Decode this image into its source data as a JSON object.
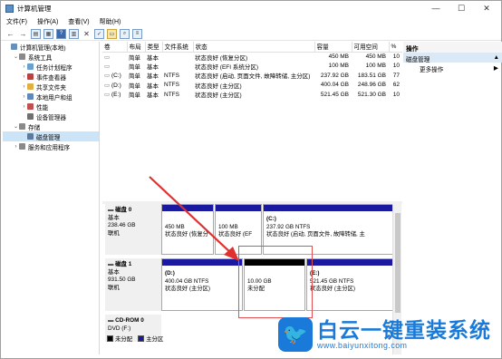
{
  "window": {
    "title": "计算机管理",
    "controls": [
      "—",
      "☐",
      "✕"
    ]
  },
  "menu": [
    "文件(F)",
    "操作(A)",
    "查看(V)",
    "帮助(H)"
  ],
  "tree": [
    {
      "label": "计算机管理(本地)",
      "level": 0,
      "expander": "",
      "color": "#6a8fb8"
    },
    {
      "label": "系统工具",
      "level": 1,
      "expander": "⌄",
      "color": "#8a8a8a"
    },
    {
      "label": "任务计划程序",
      "level": 2,
      "expander": "›",
      "color": "#6aa0d0"
    },
    {
      "label": "事件查看器",
      "level": 2,
      "expander": "›",
      "color": "#c04040"
    },
    {
      "label": "共享文件夹",
      "level": 2,
      "expander": "›",
      "color": "#e0b040"
    },
    {
      "label": "本地用户和组",
      "level": 2,
      "expander": "›",
      "color": "#5a8ac0"
    },
    {
      "label": "性能",
      "level": 2,
      "expander": "›",
      "color": "#c05050"
    },
    {
      "label": "设备管理器",
      "level": 2,
      "expander": "",
      "color": "#707070"
    },
    {
      "label": "存储",
      "level": 1,
      "expander": "⌄",
      "color": "#8a8a8a"
    },
    {
      "label": "磁盘管理",
      "level": 2,
      "expander": "",
      "color": "#5a7aa0",
      "selected": true
    },
    {
      "label": "服务和应用程序",
      "level": 1,
      "expander": "›",
      "color": "#8a8a8a"
    }
  ],
  "volume_table": {
    "headers": [
      "卷",
      "布局",
      "类型",
      "文件系统",
      "状态",
      "容量",
      "可用空间",
      "%"
    ],
    "rows": [
      [
        "",
        "简单",
        "基本",
        "",
        "状态良好 (恢复分区)",
        "450 MB",
        "450 MB",
        "10"
      ],
      [
        "",
        "简单",
        "基本",
        "",
        "状态良好 (EFI 系统分区)",
        "100 MB",
        "100 MB",
        "10"
      ],
      [
        "(C:)",
        "简单",
        "基本",
        "NTFS",
        "状态良好 (启动, 页面文件, 故障转储, 主分区)",
        "237.92 GB",
        "183.51 GB",
        "77"
      ],
      [
        "(D:)",
        "简单",
        "基本",
        "NTFS",
        "状态良好 (主分区)",
        "400.04 GB",
        "248.96 GB",
        "62"
      ],
      [
        "(E:)",
        "简单",
        "基本",
        "NTFS",
        "状态良好 (主分区)",
        "521.45 GB",
        "521.30 GB",
        "10"
      ]
    ]
  },
  "disks": [
    {
      "name": "磁盘 0",
      "type": "基本",
      "size": "238.46 GB",
      "status": "联机",
      "partitions": [
        {
          "title": "",
          "line1": "450 MB",
          "line2": "状态良好 (恢复分",
          "bar": "blue"
        },
        {
          "title": "",
          "line1": "100 MB",
          "line2": "状态良好 (EF",
          "bar": "blue"
        },
        {
          "title": "(C:)",
          "line1": "237.92 GB NTFS",
          "line2": "状态良好 (启动, 页面文件, 故障转储, 主",
          "bar": "blue"
        }
      ]
    },
    {
      "name": "磁盘 1",
      "type": "基本",
      "size": "931.50 GB",
      "status": "联机",
      "partitions": [
        {
          "title": "(D:)",
          "line1": "400.04 GB NTFS",
          "line2": "状态良好 (主分区)",
          "bar": "blue"
        },
        {
          "title": "",
          "line1": "10.00 GB",
          "line2": "未分配",
          "bar": "black"
        },
        {
          "title": "(E:)",
          "line1": "521.45 GB NTFS",
          "line2": "状态良好 (主分区)",
          "bar": "blue"
        }
      ]
    },
    {
      "name": "CD-ROM 0",
      "type": "DVD (F:)",
      "size": "",
      "status": "",
      "partitions": []
    }
  ],
  "legend": [
    {
      "label": "未分配",
      "color": "#000000"
    },
    {
      "label": "主分区",
      "color": "#1a1aa0"
    }
  ],
  "actions": {
    "header": "操作",
    "section": "磁盘管理",
    "item": "更多操作"
  },
  "watermark": {
    "logo": "🐦",
    "cn": "白云一键重装系统",
    "url": "www.baiyunxitong.com"
  }
}
